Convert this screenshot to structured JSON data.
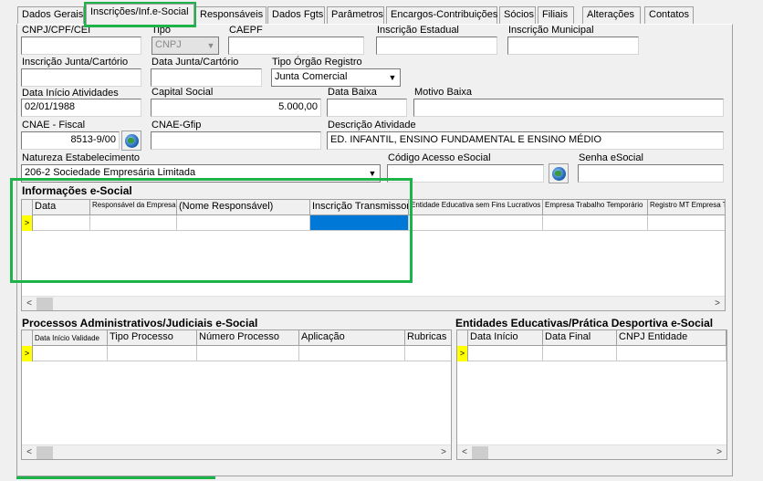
{
  "tabs": [
    "Dados Gerais",
    "Inscrições/Inf.e-Social",
    "Responsáveis",
    "Dados Fgts",
    "Parâmetros",
    "Encargos-Contribuições",
    "Sócios",
    "Filiais",
    "Alterações",
    "Contatos"
  ],
  "form": {
    "cnpj_label": "CNPJ/CPF/CEI",
    "cnpj_value": "",
    "tipo_label": "Tipo",
    "tipo_value": "CNPJ",
    "caepf_label": "CAEPF",
    "caepf_value": "",
    "insc_est_label": "Inscrição Estadual",
    "insc_est_value": "",
    "insc_mun_label": "Inscrição Municipal",
    "insc_mun_value": "",
    "insc_junta_label": "Inscrição Junta/Cartório",
    "insc_junta_value": "",
    "data_junta_label": "Data Junta/Cartório",
    "data_junta_value": "",
    "tipo_orgao_label": "Tipo Órgão Registro",
    "tipo_orgao_value": "Junta Comercial",
    "data_inicio_label": "Data Início Atividades",
    "data_inicio_value": "02/01/1988",
    "capital_label": "Capital Social",
    "capital_value": "5.000,00",
    "data_baixa_label": "Data Baixa",
    "data_baixa_value": "",
    "motivo_baixa_label": "Motivo Baixa",
    "motivo_baixa_value": "",
    "cnae_fiscal_label": "CNAE - Fiscal",
    "cnae_fiscal_value": "8513-9/00",
    "cnae_gfip_label": "CNAE-Gfip",
    "cnae_gfip_value": "",
    "desc_atividade_label": "Descrição Atividade",
    "desc_atividade_value": "ED. INFANTIL, ENSINO FUNDAMENTAL E ENSINO MÉDIO",
    "natureza_label": "Natureza Estabelecimento",
    "natureza_value": "206-2 Sociedade Empresária Limitada",
    "codigo_acesso_label": "Código Acesso eSocial",
    "codigo_acesso_value": "",
    "senha_label": "Senha eSocial",
    "senha_value": ""
  },
  "info_esocial": {
    "title": "Informações e-Social",
    "columns": [
      "Data",
      "Responsável da Empresa",
      "(Nome Responsável)",
      "Inscrição Transmissor",
      "Entidade Educativa sem Fins Lucrativos",
      "Empresa Trabalho Temporário",
      "Registro MT Empresa Trabalho Temporário"
    ]
  },
  "processos": {
    "title": "Processos Administrativos/Judiciais e-Social",
    "columns": [
      "Data Início Validade",
      "Tipo Processo",
      "Número Processo",
      "Aplicação",
      "Rubricas"
    ]
  },
  "entidades": {
    "title": "Entidades Educativas/Prática Desportiva e-Social",
    "columns": [
      "Data Início",
      "Data Final",
      "CNPJ Entidade"
    ]
  },
  "icons": {
    "globe": "globe-icon",
    "row_pointer": "row-pointer-icon",
    "dropdown": "chevron-down-icon",
    "scroll_left": "arrow-left-icon",
    "scroll_right": "arrow-right-icon"
  },
  "colors": {
    "highlight": "#1db34a",
    "selected_cell": "#0078d7",
    "row_indicator": "#ffff00"
  }
}
